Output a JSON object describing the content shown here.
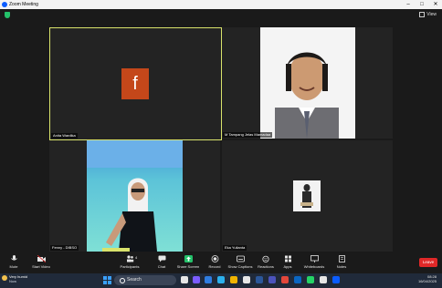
{
  "window": {
    "title": "Zoom Meeting"
  },
  "header": {
    "view_label": "View"
  },
  "participants": [
    {
      "name": "Anita Wardika",
      "avatar_letter": "f"
    },
    {
      "name": "M Tampang Jelas Mamadaa"
    },
    {
      "name": "Fenny - DIBSO"
    },
    {
      "name": "Eka Yulianta"
    }
  ],
  "toolbar": {
    "mute": "Mute",
    "start_video": "Start Video",
    "participants": "Participants",
    "participants_count": "4",
    "chat": "Chat",
    "share_screen": "Share Screen",
    "record": "Record",
    "show_captions": "Show Captions",
    "reactions": "Reactions",
    "apps": "Apps",
    "whiteboards": "Whiteboards",
    "notes": "Notes",
    "leave": "Leave"
  },
  "taskbar": {
    "weather_title": "Very humid",
    "weather_sub": "Now",
    "search_placeholder": "Search",
    "time": "08:28",
    "date": "16/04/2025"
  },
  "colors": {
    "active_speaker_border": "#d9e36b",
    "share_screen_green": "#24c16a",
    "leave_red": "#e02828",
    "avatar_bg": "#c4471a"
  }
}
